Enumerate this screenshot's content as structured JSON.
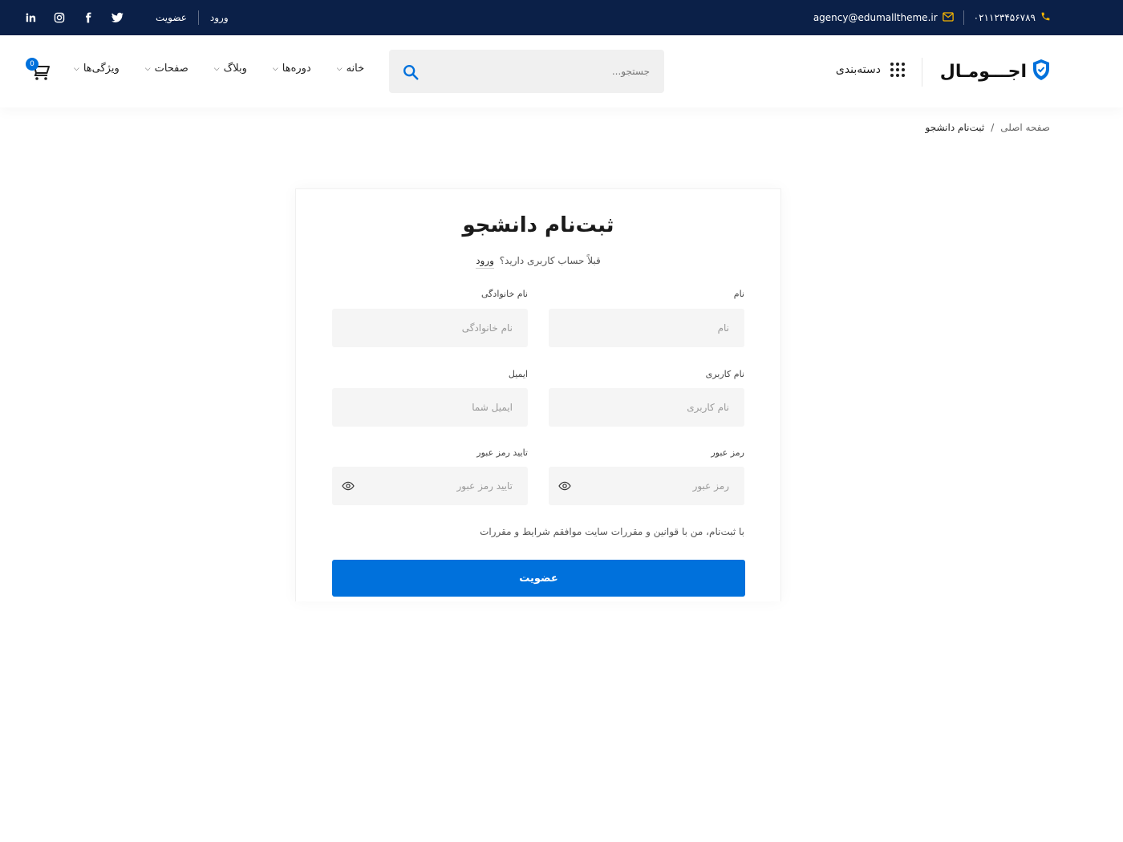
{
  "topbar": {
    "phone": "۰۲۱۱۲۳۴۵۶۷۸۹",
    "email": "agency@edumalltheme.ir",
    "login_label": "ورود",
    "register_label": "عضویت",
    "social_icons": [
      "twitter-icon",
      "facebook-icon",
      "instagram-icon",
      "linkedin-icon"
    ]
  },
  "header": {
    "logo_text": "اجـــومـال",
    "category_label": "دسته‌بندی",
    "search_placeholder": "جستجو...",
    "nav": [
      {
        "label": "خانه"
      },
      {
        "label": "دوره‌ها"
      },
      {
        "label": "وبلاگ"
      },
      {
        "label": "صفحات"
      },
      {
        "label": "ویژگی‌ها"
      }
    ],
    "cart_count": "0"
  },
  "breadcrumb": {
    "home": "صفحه اصلی",
    "separator": "/",
    "current": "ثبت‌نام دانشجو"
  },
  "form": {
    "title": "ثبت‌نام دانشجو",
    "subtitle": "قبلاً حساب کاربری دارید؟",
    "login_link": "ورود",
    "first_name_label": "نام",
    "first_name_placeholder": "نام",
    "last_name_label": "نام خانوادگی",
    "last_name_placeholder": "نام خانوادگی",
    "username_label": "نام کاربری",
    "username_placeholder": "نام کاربری",
    "email_label": "ایمیل",
    "email_placeholder": "ایمیل شما",
    "password_label": "رمز عبور",
    "password_placeholder": "رمز عبور",
    "confirm_label": "تایید رمز عبور",
    "confirm_placeholder": "تایید رمز عبور",
    "terms_text": "با ثبت‌نام، من با قوانین و مقررات سایت موافقم شرایط و مقررات",
    "submit_label": "عضویت"
  },
  "colors": {
    "topbar_bg": "#0b2048",
    "accent": "#0071dc",
    "icon_accent": "#f5b400"
  }
}
